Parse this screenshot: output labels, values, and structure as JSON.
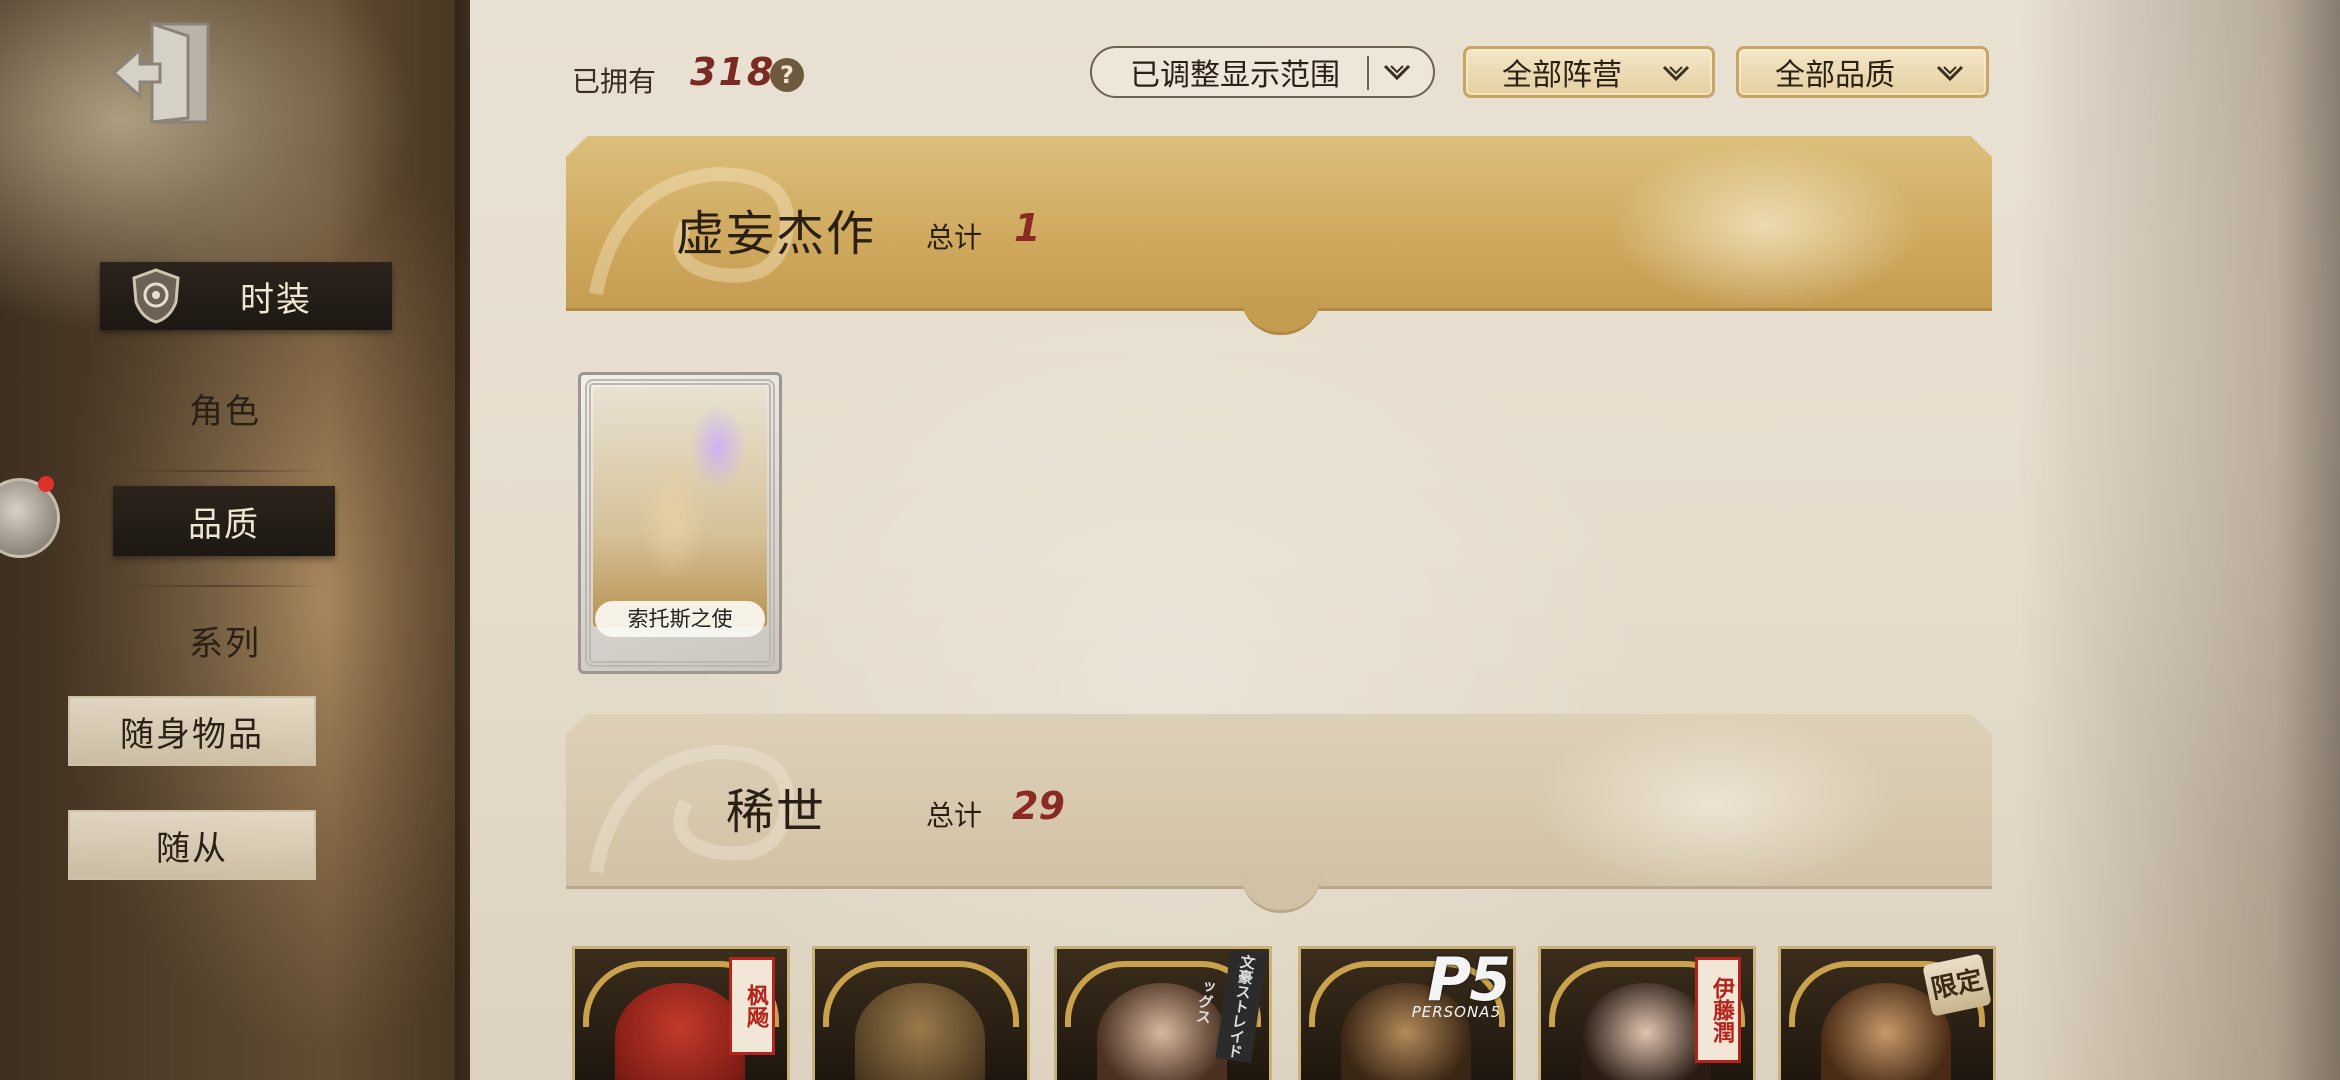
{
  "sidebar": {
    "items": [
      {
        "label": "时装",
        "state": "active"
      },
      {
        "label": "角色",
        "state": "normal"
      },
      {
        "label": "品质",
        "state": "selected"
      },
      {
        "label": "系列",
        "state": "normal"
      },
      {
        "label": "随身物品",
        "state": "boxed"
      },
      {
        "label": "随从",
        "state": "boxed"
      }
    ],
    "exit_icon": "exit-door-icon",
    "badge_color": "#e0302a"
  },
  "header": {
    "owned_label": "已拥有",
    "owned_count": "318",
    "help_label": "?",
    "range_filter": "已调整显示范围",
    "camp_filter": "全部阵营",
    "quality_filter": "全部品质"
  },
  "sections": [
    {
      "title": "虚妄杰作",
      "total_label": "总计",
      "total": "1",
      "style": "gold",
      "cards": [
        {
          "name": "索托斯之使"
        }
      ]
    },
    {
      "title": "稀世",
      "total_label": "总计",
      "total": "29",
      "style": "plain",
      "cards": [
        {
          "tag": "枫飏"
        },
        {
          "tag": ""
        },
        {
          "tag": "文豪ストレイドッグス"
        },
        {
          "tag": "P5",
          "tag_sub": "PERSONA5"
        },
        {
          "tag": "伊藤潤"
        },
        {
          "tag": "限定"
        }
      ]
    }
  ],
  "colors": {
    "accent_red": "#7a2a22",
    "gold_banner": "#cfa95e",
    "paper": "#e6ddcd"
  }
}
